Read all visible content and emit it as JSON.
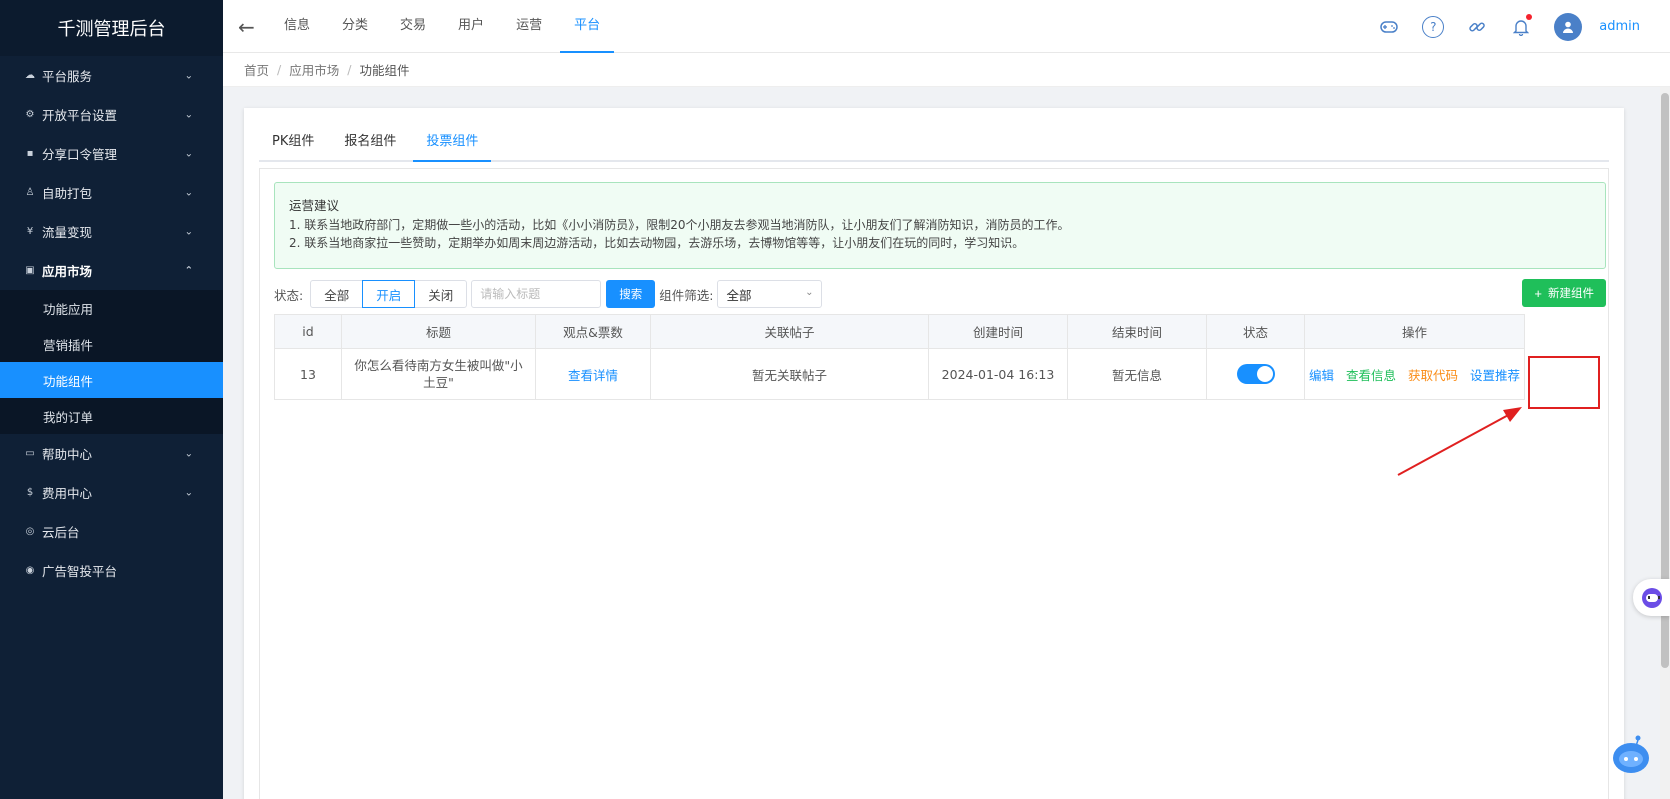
{
  "app": {
    "title": "千测管理后台"
  },
  "sidebar": {
    "items": [
      {
        "icon": "☁",
        "label": "平台服务"
      },
      {
        "icon": "⚙",
        "label": "开放平台设置"
      },
      {
        "icon": "▪",
        "label": "分享口令管理"
      },
      {
        "icon": "♙",
        "label": "自助打包"
      },
      {
        "icon": "¥",
        "label": "流量变现"
      },
      {
        "icon": "▣",
        "label": "应用市场",
        "expanded": true
      }
    ],
    "subitems": [
      {
        "label": "功能应用"
      },
      {
        "label": "营销插件"
      },
      {
        "label": "功能组件",
        "active": true
      },
      {
        "label": "我的订单"
      }
    ],
    "items_after": [
      {
        "icon": "▭",
        "label": "帮助中心"
      },
      {
        "icon": "$",
        "label": "费用中心"
      },
      {
        "icon": "◎",
        "label": "云后台"
      },
      {
        "icon": "◉",
        "label": "广告智投平台"
      }
    ]
  },
  "topnav": {
    "tabs": [
      {
        "label": "信息"
      },
      {
        "label": "分类"
      },
      {
        "label": "交易"
      },
      {
        "label": "用户"
      },
      {
        "label": "运营"
      },
      {
        "label": "平台",
        "active": true
      }
    ],
    "username": "admin",
    "icons": [
      "gamepad-icon",
      "help-icon",
      "link-icon",
      "bell-icon"
    ]
  },
  "breadcrumb": {
    "home": "首页",
    "parent": "应用市场",
    "current": "功能组件"
  },
  "tabs": [
    {
      "label": "PK组件"
    },
    {
      "label": "报名组件"
    },
    {
      "label": "投票组件",
      "active": true
    }
  ],
  "notice": {
    "title": "运营建议",
    "line1": "1. 联系当地政府部门，定期做一些小的活动，比如《小小消防员》，限制20个小朋友去参观当地消防队，让小朋友们了解消防知识，消防员的工作。",
    "line2": "2. 联系当地商家拉一些赞助，定期举办如周末周边游活动，比如去动物园，去游乐场，去博物馆等等，让小朋友们在玩的同时，学习知识。"
  },
  "filters": {
    "status_label": "状态:",
    "status_options": [
      "全部",
      "开启",
      "关闭"
    ],
    "status_selected": "开启",
    "search_placeholder": "请输入标题",
    "search_button": "搜索",
    "component_label": "组件筛选:",
    "component_value": "全部",
    "new_button": "新建组件"
  },
  "table": {
    "headers": [
      "id",
      "标题",
      "观点&票数",
      "关联帖子",
      "创建时间",
      "结束时间",
      "状态",
      "操作"
    ],
    "rows": [
      {
        "id": "13",
        "title": "你怎么看待南方女生被叫做\"小土豆\"",
        "votes_link": "查看详情",
        "post": "暂无关联帖子",
        "created": "2024-01-04 16:13",
        "ended": "暂无信息",
        "status_on": true,
        "ops": {
          "edit": "编辑",
          "view": "查看信息",
          "code": "获取代码",
          "recommend": "设置推荐"
        }
      }
    ]
  },
  "colors": {
    "primary": "#1890ff",
    "success": "#1fbf5a",
    "warning": "#fa8c16",
    "sidebar": "#0f2036",
    "annotation": "#e02020"
  }
}
